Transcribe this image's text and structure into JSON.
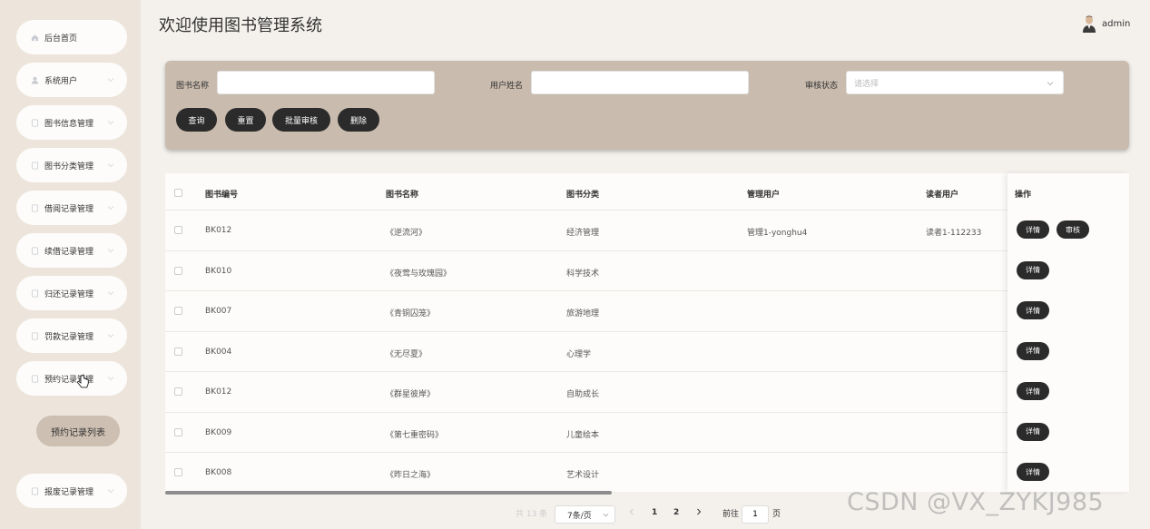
{
  "sidebar": {
    "items": [
      {
        "label": "后台首页",
        "icon": "home-icon",
        "has_chevron": false
      },
      {
        "label": "系统用户",
        "icon": "user-icon",
        "has_chevron": true
      },
      {
        "label": "图书信息管理",
        "icon": "document-icon",
        "has_chevron": true
      },
      {
        "label": "图书分类管理",
        "icon": "document-icon",
        "has_chevron": true
      },
      {
        "label": "借阅记录管理",
        "icon": "document-icon",
        "has_chevron": true
      },
      {
        "label": "续借记录管理",
        "icon": "document-icon",
        "has_chevron": true
      },
      {
        "label": "归还记录管理",
        "icon": "document-icon",
        "has_chevron": true
      },
      {
        "label": "罚款记录管理",
        "icon": "document-icon",
        "has_chevron": true
      },
      {
        "label": "预约记录管理",
        "icon": "document-icon",
        "has_chevron": true
      },
      {
        "label": "报废记录管理",
        "icon": "document-icon",
        "has_chevron": true
      }
    ],
    "submenu_active": "预约记录列表"
  },
  "header": {
    "title": "欢迎使用图书管理系统",
    "user": "admin"
  },
  "search": {
    "book_name_label": "图书名称",
    "user_name_label": "用户姓名",
    "status_label": "审核状态",
    "status_placeholder": "请选择",
    "buttons": {
      "query": "查询",
      "reset": "重置",
      "batch_review": "批量审核",
      "delete": "删除"
    }
  },
  "table": {
    "headers": {
      "code": "图书编号",
      "name": "图书名称",
      "category": "图书分类",
      "manager": "管理用户",
      "reader": "读者用户",
      "ops": "操作"
    },
    "rows": [
      {
        "code": "BK012",
        "name": "《逆流河》",
        "category": "经济管理",
        "manager": "管理1-yonghu4",
        "reader": "读者1-112233",
        "review": true
      },
      {
        "code": "BK010",
        "name": "《夜莺与玫瑰园》",
        "category": "科学技术",
        "manager": "",
        "reader": "",
        "review": false
      },
      {
        "code": "BK007",
        "name": "《青铜囚笼》",
        "category": "旅游地理",
        "manager": "",
        "reader": "",
        "review": false
      },
      {
        "code": "BK004",
        "name": "《无尽夏》",
        "category": "心理学",
        "manager": "",
        "reader": "",
        "review": false
      },
      {
        "code": "BK012",
        "name": "《群星彼岸》",
        "category": "自助成长",
        "manager": "",
        "reader": "",
        "review": false
      },
      {
        "code": "BK009",
        "name": "《第七重密码》",
        "category": "儿童绘本",
        "manager": "",
        "reader": "",
        "review": false
      },
      {
        "code": "BK008",
        "name": "《昨日之海》",
        "category": "艺术设计",
        "manager": "",
        "reader": "",
        "review": false
      }
    ],
    "detail_label": "详情",
    "review_label": "审核"
  },
  "pagination": {
    "total": "共 13 条",
    "page_size": "7条/页",
    "pages": [
      "1",
      "2"
    ],
    "goto_label": "前往",
    "goto_value": "1",
    "page_unit": "页"
  },
  "watermark": "CSDN @VX_ZYKJ985",
  "colors": {
    "sidebar_bg": "#ede5dc",
    "panel_bg": "#c9bbae",
    "button_dark": "#2b2b2b",
    "submenu_active_bg": "#cdbfb1"
  }
}
